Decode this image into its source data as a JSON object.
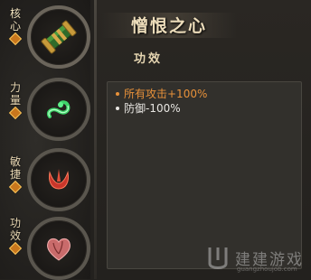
{
  "categories": [
    {
      "chars": [
        "核",
        "心"
      ],
      "icon": "scroll-icon",
      "active": true
    },
    {
      "chars": [
        "力",
        "量"
      ],
      "icon": "green-serpent-icon",
      "active": false
    },
    {
      "chars": [
        "敏",
        "捷"
      ],
      "icon": "red-claw-icon",
      "active": false
    },
    {
      "chars": [
        "功",
        "效"
      ],
      "icon": "heart-icon",
      "active": false
    }
  ],
  "panel": {
    "title": "憎恨之心",
    "subtitle": "功效",
    "effects": [
      {
        "text": "所有攻击+100%",
        "color": "#e8913a"
      },
      {
        "text": "防御-100%",
        "color": "#e8e6e2"
      }
    ]
  },
  "watermark": {
    "text": "建建游戏",
    "url": "guangzhoujob.com"
  },
  "colors": {
    "accent_orange": "#e8913a",
    "title_gold": "#ecdcba"
  }
}
